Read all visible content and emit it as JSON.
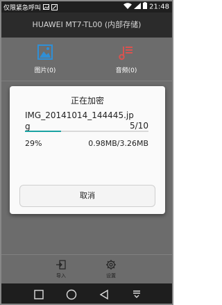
{
  "status_bar": {
    "carrier_text": "仅限紧急呼叫",
    "time": "21:48",
    "icons": [
      "photo-icon",
      "nfc-icon",
      "wifi-icon",
      "signal-icon",
      "battery-icon"
    ]
  },
  "title_bar": {
    "title": "HUAWEI MT7-TL00 (内部存储)"
  },
  "categories": [
    {
      "label": "图片(0)",
      "icon": "image-icon"
    },
    {
      "label": "音频(0)",
      "icon": "music-icon"
    }
  ],
  "dialog": {
    "title": "正在加密",
    "filename": "IMG_20141014_144445.jpg",
    "count": "5/10",
    "percent_text": "29%",
    "progress": 0.29,
    "size_text": "0.98MB/3.26MB",
    "cancel_label": "取消",
    "accent_color": "#1aa3a3"
  },
  "bottom_bar": {
    "import_label": "导入",
    "settings_label": "设置"
  },
  "nav_bar": {
    "icons": [
      "recent-apps-icon",
      "home-icon",
      "back-icon",
      "notification-pull-icon"
    ]
  }
}
